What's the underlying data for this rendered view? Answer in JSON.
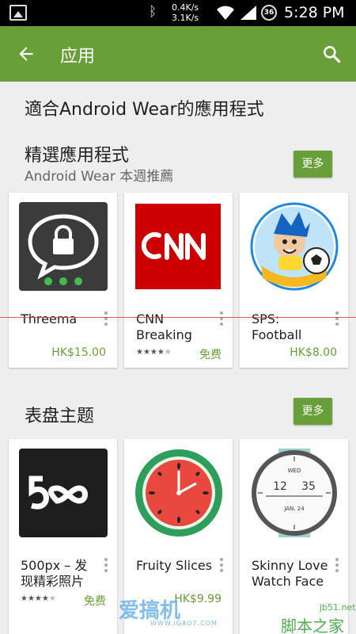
{
  "status_bar": {
    "speed_up": "0.4K/s",
    "speed_down": "3.1K/s",
    "battery": "36",
    "time": "5:28 PM",
    "icons": [
      "gallery-icon",
      "bluetooth-icon",
      "wifi-icon",
      "signal-icon",
      "battery-icon"
    ]
  },
  "app_bar": {
    "title": "应用",
    "back_icon": "arrow-back-icon",
    "search_icon": "search-icon"
  },
  "page_heading": "適合Android Wear的應用程式",
  "sections": [
    {
      "title": "精選應用程式",
      "subtitle": "Android Wear 本週推薦",
      "more_label": "更多",
      "cards": [
        {
          "name": "Threema",
          "price": "HK$15.00",
          "rating": null,
          "icon": "threema-lock-icon"
        },
        {
          "name": "CNN Breaking",
          "price": "免费",
          "rating": 3.5,
          "icon": "cnn-logo-icon"
        },
        {
          "name": "SPS: Football",
          "price": "HK$8.00",
          "rating": null,
          "icon": "sps-football-icon"
        }
      ]
    },
    {
      "title": "表盘主题",
      "subtitle": "",
      "more_label": "更多",
      "cards": [
        {
          "name": "500px – 发现精彩照片",
          "price": "免费",
          "rating": 4,
          "icon": "500px-logo-icon"
        },
        {
          "name": "Fruity Slices",
          "price": "HK$9.99",
          "rating": null,
          "icon": "watermelon-watch-icon"
        },
        {
          "name": "Skinny Love Watch Face",
          "price": "",
          "rating": null,
          "icon": "skinny-love-watch-icon"
        }
      ]
    }
  ],
  "watermarks": {
    "left_main": "爱搞机",
    "left_sub": "WWW.IGAO7.COM",
    "right_top": "jb51.net",
    "right_main": "脚本之家"
  },
  "colors": {
    "accent": "#689f38",
    "status_bar": "#000000",
    "background": "#eeeeee",
    "cnn_red": "#cc0000"
  }
}
